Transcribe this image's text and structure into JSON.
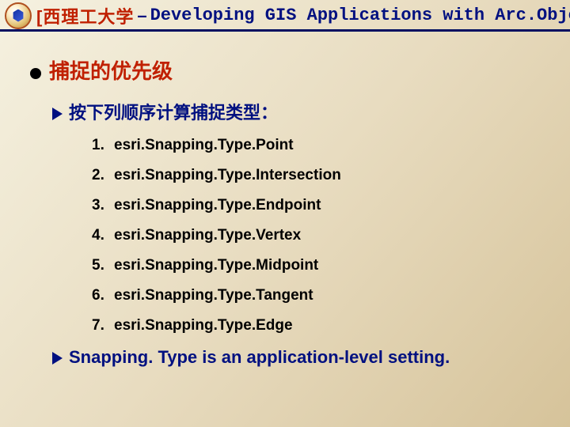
{
  "header": {
    "university": "[西理工大学",
    "separator": "–",
    "course": "Developing GIS Applications with Arc.Objects using C#. NE"
  },
  "title": "捕捉的优先级",
  "subtitle": "按下列顺序计算捕捉类型：",
  "types": [
    "esri.Snapping.Type.Point",
    "esri.Snapping.Type.Intersection",
    "esri.Snapping.Type.Endpoint",
    "esri.Snapping.Type.Vertex",
    "esri.Snapping.Type.Midpoint",
    "esri.Snapping.Type.Tangent",
    "esri.Snapping.Type.Edge"
  ],
  "note": "Snapping. Type is an application-level setting."
}
